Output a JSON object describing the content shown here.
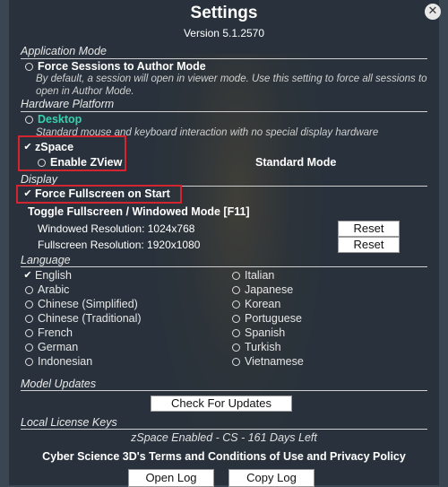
{
  "window": {
    "title": "Settings",
    "version": "Version 5.1.2570",
    "close_glyph": "✕"
  },
  "application_mode": {
    "header": "Application Mode",
    "option_label": "Force Sessions to Author Mode",
    "description": "By default, a session will open in viewer mode. Use this setting to force all sessions to open in Author Mode."
  },
  "hardware_platform": {
    "header": "Hardware Platform",
    "desktop_label": "Desktop",
    "desktop_description": "Standard mouse and keyboard interaction with no special display hardware",
    "zspace_label": "zSpace",
    "zspace_checked": true,
    "zview_label": "Enable ZView",
    "zview_checked": false,
    "mode_label": "Standard Mode"
  },
  "display": {
    "header": "Display",
    "force_fullscreen_label": "Force Fullscreen on Start",
    "force_fullscreen_checked": true,
    "toggle_label": "Toggle Fullscreen / Windowed Mode [F11]",
    "windowed_resolution": "Windowed Resolution: 1024x768",
    "fullscreen_resolution": "Fullscreen Resolution: 1920x1080",
    "reset_label": "Reset"
  },
  "language": {
    "header": "Language",
    "selected": "English",
    "left": [
      "English",
      "Arabic",
      "Chinese (Simplified)",
      "Chinese (Traditional)",
      "French",
      "German",
      "Indonesian"
    ],
    "right": [
      "Italian",
      "Japanese",
      "Korean",
      "Portuguese",
      "Spanish",
      "Turkish",
      "Vietnamese"
    ]
  },
  "model_updates": {
    "header": "Model Updates",
    "button_label": "Check For Updates"
  },
  "license": {
    "header": "Local License Keys",
    "status": "zSpace Enabled - CS - 161 Days Left",
    "terms_link": "Cyber Science 3D's Terms and Conditions of Use and Privacy Policy"
  },
  "footer": {
    "open_log_label": "Open Log",
    "copy_log_label": "Copy Log"
  },
  "colors": {
    "accent_desktop": "#34d1b0",
    "highlight": "#d3252f"
  }
}
